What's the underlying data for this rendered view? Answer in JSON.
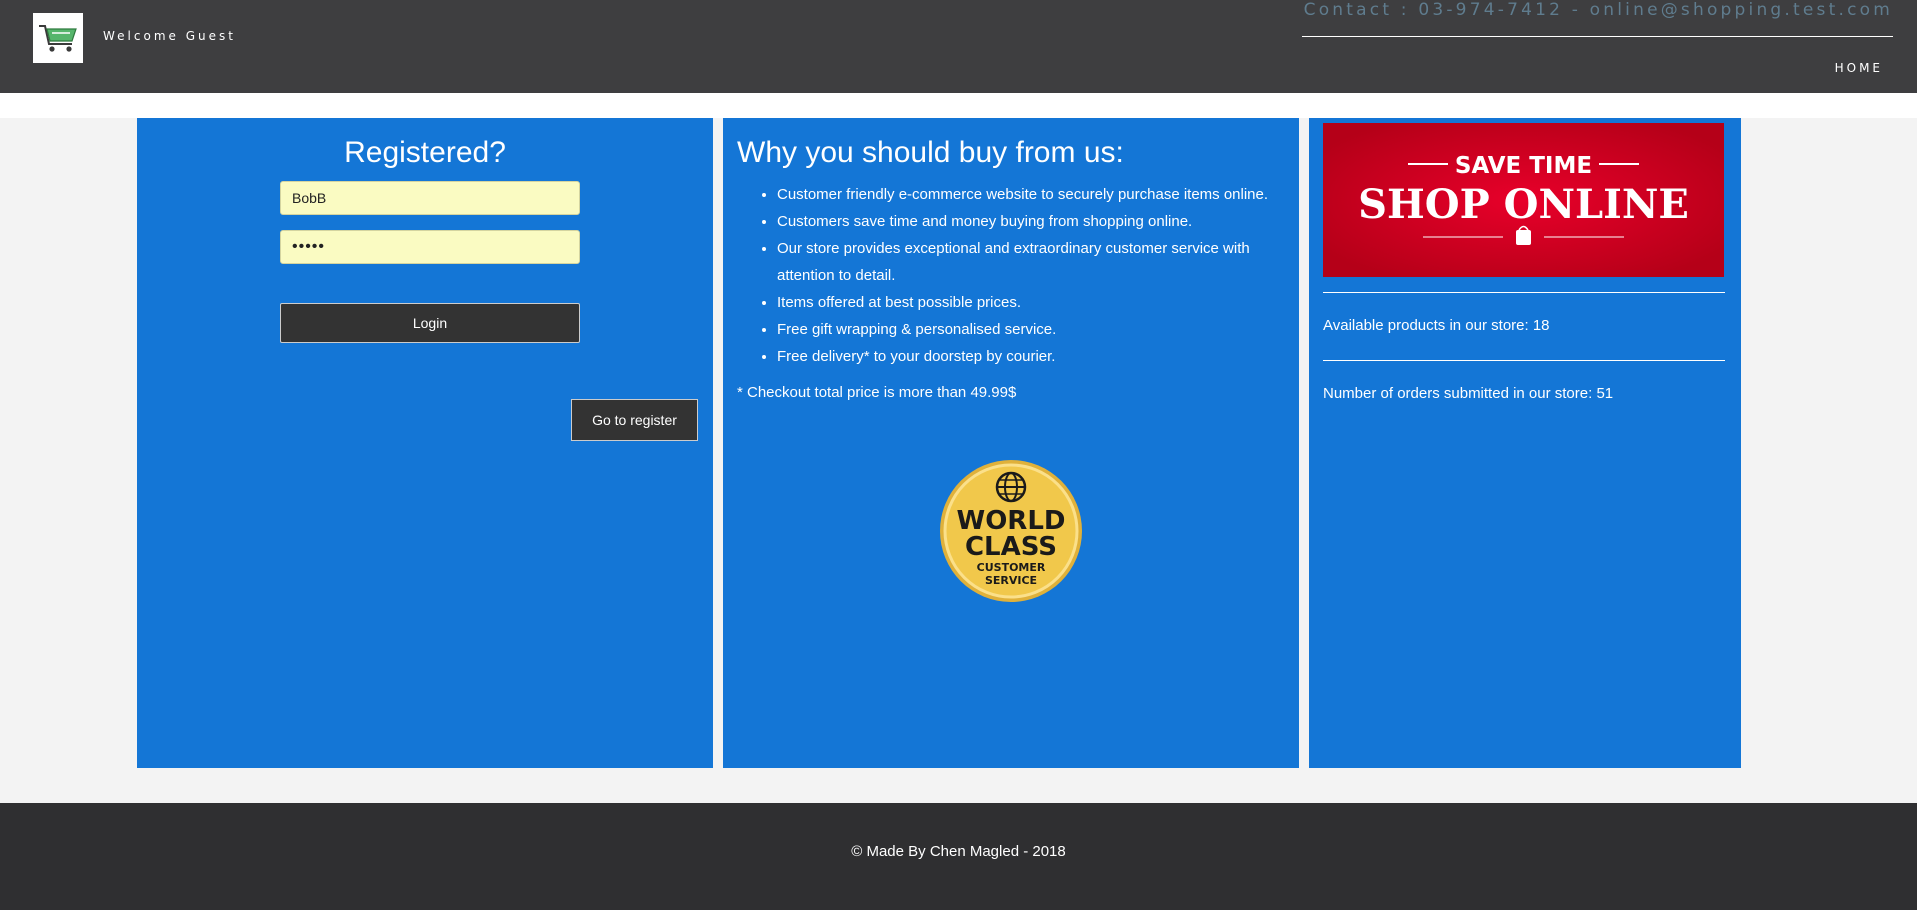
{
  "header": {
    "welcome": "Welcome Guest",
    "contact": "Contact : 03-974-7412 - online@shopping.test.com",
    "nav_home": "HOME"
  },
  "login": {
    "title": "Registered?",
    "username_value": "BobB",
    "password_value": "•••••",
    "login_label": "Login",
    "register_label": "Go to register"
  },
  "why": {
    "title": "Why you should buy from us:",
    "items": [
      "Customer friendly e-commerce website to securely purchase items online.",
      "Customers save time and money buying from shopping online.",
      "Our store provides exceptional and extraordinary customer service with attention to detail.",
      "Items offered at best possible prices.",
      "Free gift wrapping & personalised service.",
      "Free delivery* to your doorstep by courier."
    ],
    "note": "* Checkout total price is more than 49.99$",
    "badge": {
      "line1": "WORLD",
      "line2": "CLASS",
      "line3": "CUSTOMER",
      "line4": "SERVICE"
    }
  },
  "store": {
    "banner_top": "SAVE TIME",
    "banner_main": "SHOP ONLINE",
    "available": "Available products in our store: 18",
    "orders": "Number of orders submitted in our store: 51"
  },
  "footer": {
    "text": "© Made By Chen Magled - 2018"
  },
  "colors": {
    "header_bg": "#3e3e40",
    "panel_blue": "#1476d6",
    "input_bg": "#fafbc2",
    "button_dark": "#333333",
    "footer_bg": "#2f2f31",
    "banner_red": "#d8001f",
    "badge_gold": "#f1c84b"
  }
}
